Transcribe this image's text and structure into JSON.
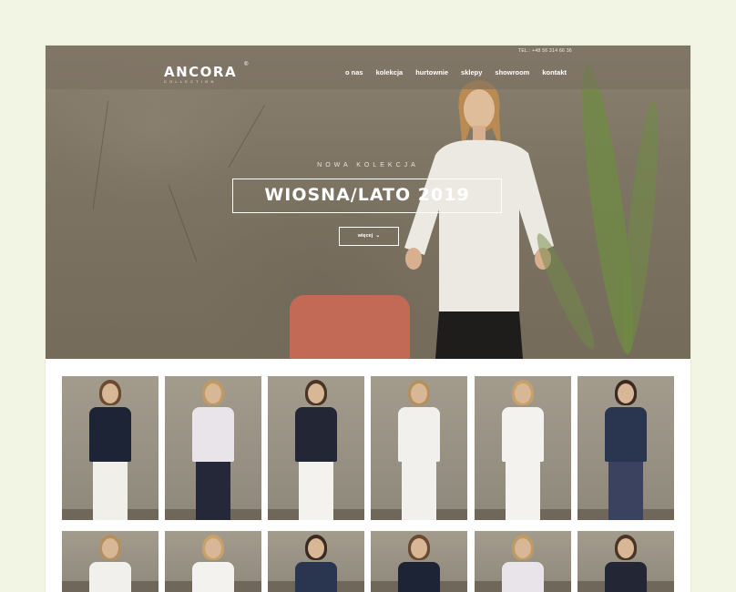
{
  "header": {
    "phone": "TEL.: +48 56 314 66 36",
    "logo": "ANCORA",
    "logo_reg": "®",
    "logo_sub": "COLLECTION"
  },
  "nav": {
    "items": [
      {
        "label": "o nas"
      },
      {
        "label": "kolekcja"
      },
      {
        "label": "hurtownie"
      },
      {
        "label": "sklepy"
      },
      {
        "label": "showroom"
      },
      {
        "label": "kontakt"
      }
    ]
  },
  "hero": {
    "kicker": "NOWA KOLEKCJA",
    "headline": "WIOSNA/LATO 2019",
    "button_label": "więcej",
    "button_icon": "chevron-down-icon"
  },
  "grid": {
    "row1": [
      {
        "name": "look-1"
      },
      {
        "name": "look-2"
      },
      {
        "name": "look-3"
      },
      {
        "name": "look-4"
      },
      {
        "name": "look-5"
      },
      {
        "name": "look-6"
      }
    ],
    "row2": [
      {
        "name": "look-7"
      },
      {
        "name": "look-8"
      },
      {
        "name": "look-9"
      },
      {
        "name": "look-10"
      },
      {
        "name": "look-11"
      },
      {
        "name": "look-12"
      }
    ]
  },
  "colors": {
    "background": "#f3f5e4",
    "accent_white": "#ffffff",
    "chair": "#c26a55",
    "plant": "#6f8a45"
  }
}
